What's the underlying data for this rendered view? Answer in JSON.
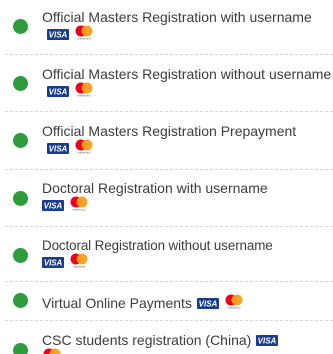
{
  "menu": {
    "items": [
      {
        "label": "Official Masters Registration with username"
      },
      {
        "label": "Official Masters Registration without username"
      },
      {
        "label": "Official Masters Registration Prepayment"
      },
      {
        "label": "Doctoral Registration with username"
      },
      {
        "label": "Doctoral Registration without username"
      },
      {
        "label": "Virtual Online Payments"
      },
      {
        "label": "CSC students registration (China)"
      }
    ],
    "card_brands": {
      "visa": "VISA",
      "mastercard": "mastercard"
    }
  },
  "colors": {
    "status_dot": "#2e9b3c",
    "text": "#3c3c3c",
    "divider": "#d9d9d9",
    "visa_blue": "#1a3c8f",
    "mastercard_red": "#eb001b",
    "mastercard_yellow": "#f79e1b"
  },
  "icons": [
    "green-dot-icon",
    "visa-icon",
    "mastercard-icon"
  ]
}
